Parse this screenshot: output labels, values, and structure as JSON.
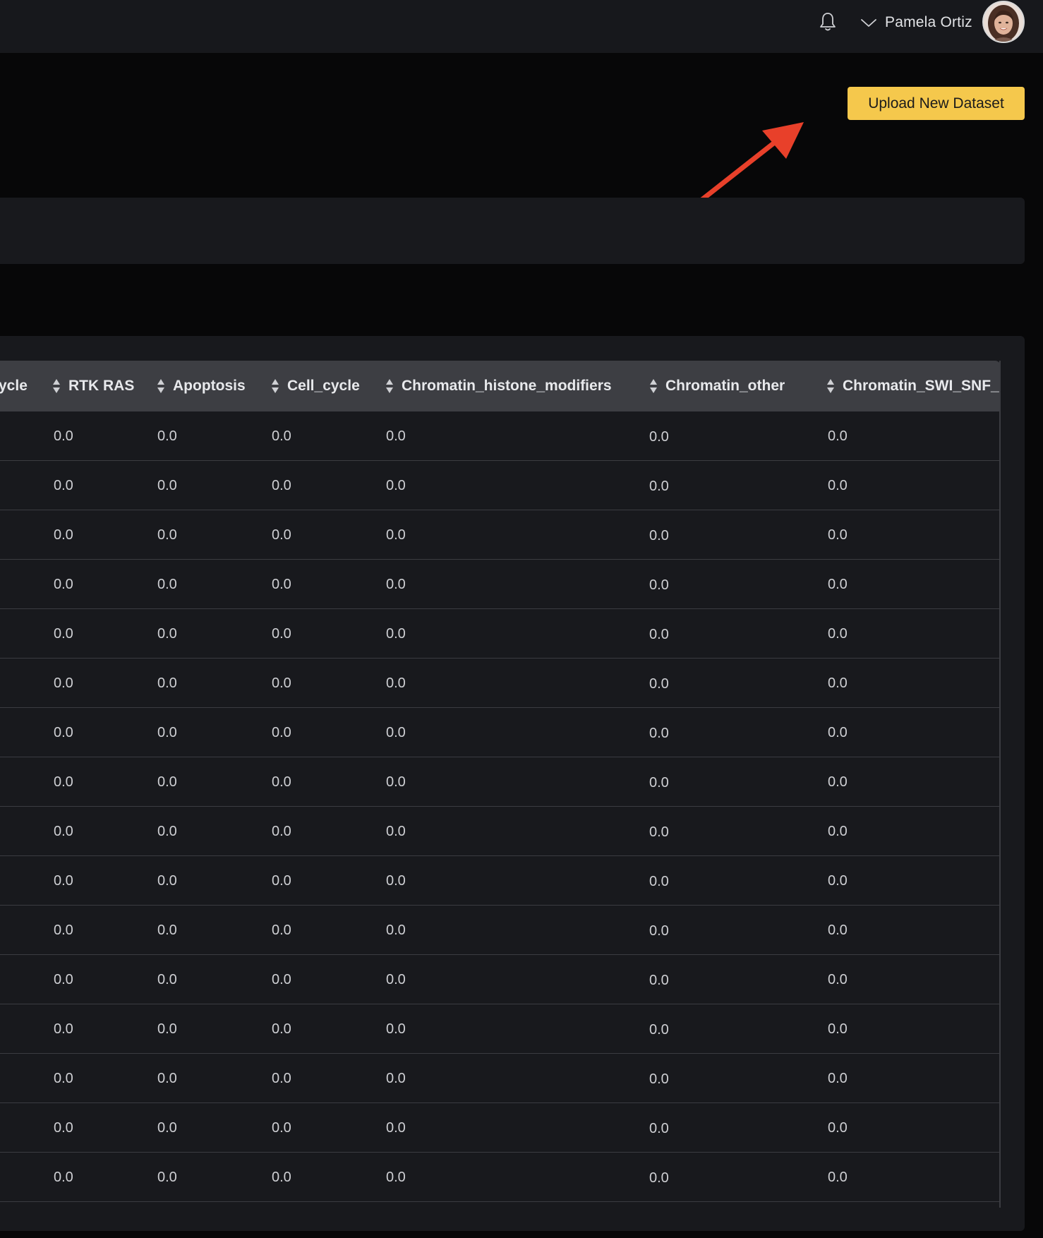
{
  "header": {
    "user_name": "Pamela Ortiz"
  },
  "actions": {
    "upload_label": "Upload New Dataset"
  },
  "table": {
    "columns": [
      "ycle",
      "RTK RAS",
      "Apoptosis",
      "Cell_cycle",
      "Chromatin_histone_modifiers",
      "Chromatin_other",
      "Chromatin_SWI_SNF_c"
    ],
    "rows": [
      [
        "0.0",
        "0.0",
        "0.0",
        "0.0",
        "0.0",
        "0.0"
      ],
      [
        "0.0",
        "0.0",
        "0.0",
        "0.0",
        "0.0",
        "0.0"
      ],
      [
        "0.0",
        "0.0",
        "0.0",
        "0.0",
        "0.0",
        "0.0"
      ],
      [
        "0.0",
        "0.0",
        "0.0",
        "0.0",
        "0.0",
        "0.0"
      ],
      [
        "0.0",
        "0.0",
        "0.0",
        "0.0",
        "0.0",
        "0.0"
      ],
      [
        "0.0",
        "0.0",
        "0.0",
        "0.0",
        "0.0",
        "0.0"
      ],
      [
        "0.0",
        "0.0",
        "0.0",
        "0.0",
        "0.0",
        "0.0"
      ],
      [
        "0.0",
        "0.0",
        "0.0",
        "0.0",
        "0.0",
        "0.0"
      ],
      [
        "0.0",
        "0.0",
        "0.0",
        "0.0",
        "0.0",
        "0.0"
      ],
      [
        "0.0",
        "0.0",
        "0.0",
        "0.0",
        "0.0",
        "0.0"
      ],
      [
        "0.0",
        "0.0",
        "0.0",
        "0.0",
        "0.0",
        "0.0"
      ],
      [
        "0.0",
        "0.0",
        "0.0",
        "0.0",
        "0.0",
        "0.0"
      ],
      [
        "0.0",
        "0.0",
        "0.0",
        "0.0",
        "0.0",
        "0.0"
      ],
      [
        "0.0",
        "0.0",
        "0.0",
        "0.0",
        "0.0",
        "0.0"
      ],
      [
        "0.0",
        "0.0",
        "0.0",
        "0.0",
        "0.0",
        "0.0"
      ],
      [
        "0.0",
        "0.0",
        "0.0",
        "0.0",
        "0.0",
        "0.0"
      ]
    ]
  },
  "icons": {
    "notifications": "bell-icon",
    "user_menu": "chevron-down-icon",
    "sort": "sort-icon",
    "annotation": "arrow-annotation"
  },
  "colors": {
    "accent": "#f5c84c",
    "annotation": "#e8402a",
    "panel": "#18191d",
    "header_row": "#3d3e43"
  }
}
